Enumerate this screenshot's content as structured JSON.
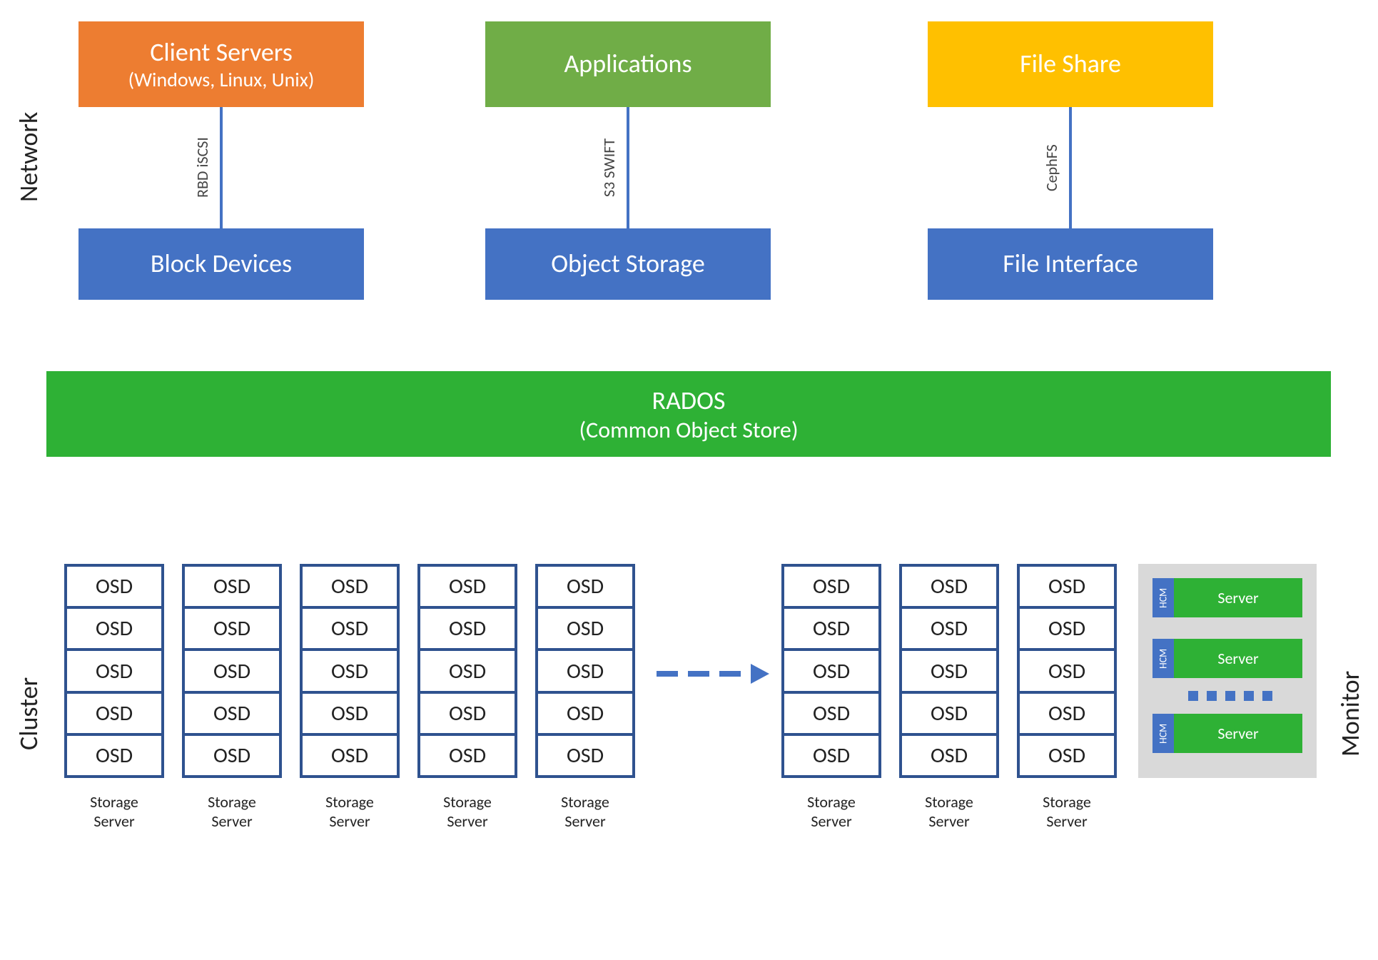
{
  "sections": {
    "network": "Network",
    "cluster": "Cluster",
    "monitor": "Monitor"
  },
  "top": {
    "client_servers": {
      "title": "Client Servers",
      "subtitle": "(Windows, Linux, Unix)"
    },
    "applications": {
      "title": "Applications"
    },
    "file_share": {
      "title": "File Share"
    }
  },
  "connectors": {
    "rbd_iscsi": "RBD iSCSI",
    "s3_swift": "S3 SWIFT",
    "cephfs": "CephFS"
  },
  "middle": {
    "block_devices": "Block Devices",
    "object_storage": "Object Storage",
    "file_interface": "File Interface"
  },
  "rados": {
    "title": "RADOS",
    "subtitle": "(Common Object Store)"
  },
  "osd_label": "OSD",
  "osd_rows": 5,
  "storage_server_label_line1": "Storage",
  "storage_server_label_line2": "Server",
  "hcm": {
    "tab": "HCM",
    "body": "Server"
  }
}
